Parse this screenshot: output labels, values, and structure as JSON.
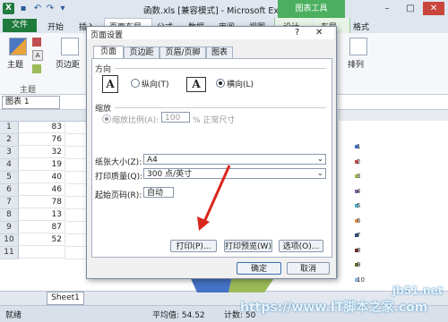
{
  "window": {
    "logo": "X",
    "title": "函数.xls [兼容模式] - Microsoft Excel",
    "context_label": "图表工具",
    "min": "–",
    "max": "□",
    "close": "✕"
  },
  "ribbon_tabs": {
    "file": "文件",
    "items": [
      "开始",
      "插入",
      "页面布局",
      "公式",
      "数据",
      "审阅",
      "视图",
      "设计",
      "布局",
      "格式"
    ]
  },
  "ribbon": {
    "group_theme": "主题",
    "margins": "页边距",
    "arrange": "排列",
    "theme_btn": "主题"
  },
  "formula_bar": {
    "name_box": "图表 1"
  },
  "grid": {
    "rows": [
      {
        "row": "1",
        "value": "83"
      },
      {
        "row": "2",
        "value": "76"
      },
      {
        "row": "3",
        "value": "32"
      },
      {
        "row": "4",
        "value": "19"
      },
      {
        "row": "5",
        "value": "40"
      },
      {
        "row": "6",
        "value": "46"
      },
      {
        "row": "7",
        "value": "78"
      },
      {
        "row": "8",
        "value": "13"
      },
      {
        "row": "9",
        "value": "87"
      },
      {
        "row": "10",
        "value": "52"
      },
      {
        "row": "11",
        "value": ""
      }
    ]
  },
  "legend": {
    "items": [
      "1",
      "2",
      "3",
      "4",
      "5",
      "6",
      "7",
      "8",
      "9",
      "10"
    ],
    "colors": [
      "#4472c4",
      "#c0504d",
      "#9bbb59",
      "#8064a2",
      "#4bacc6",
      "#f79646",
      "#2c4d75",
      "#772c2a",
      "#5f7530",
      "#8eb4e3"
    ]
  },
  "sheet_tab": "Sheet1",
  "status": {
    "ready": "就绪",
    "average": "平均值: 54.52",
    "count": "计数: 50"
  },
  "dialog": {
    "title": "页面设置",
    "help": "?",
    "close": "✕",
    "tabs": [
      "页面",
      "页边距",
      "页眉/页脚",
      "图表"
    ],
    "orientation_label": "方向",
    "portrait": "纵向(T)",
    "landscape": "横向(L)",
    "scaling_label": "缩放",
    "scale_option": "缩放比例(A):",
    "scale_value": "100",
    "scale_suffix": "% 正常尺寸",
    "paper_size_label": "纸张大小(Z):",
    "paper_size_value": "A4",
    "print_quality_label": "打印质量(Q):",
    "print_quality_value": "300 点/英寸",
    "first_page_label": "起始页码(R):",
    "first_page_value": "自动",
    "print_btn": "打印(P)...",
    "preview_btn": "打印预览(W)",
    "options_btn": "选项(O)...",
    "ok_btn": "确定",
    "cancel_btn": "取消",
    "page_letter": "A"
  },
  "watermark": {
    "site": "jb51.net",
    "brand": "https://www.IT脚本之家.com"
  }
}
